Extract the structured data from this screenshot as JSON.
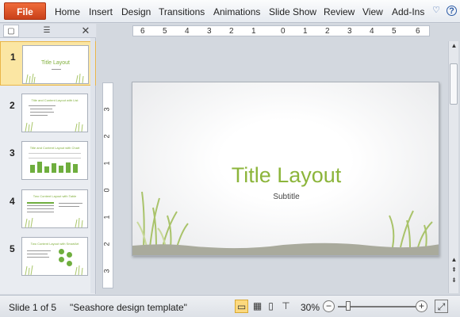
{
  "ribbon": {
    "file_label": "File",
    "tabs": [
      "Home",
      "Insert",
      "Design",
      "Transitions",
      "Animations",
      "Slide Show",
      "Review",
      "View",
      "Add-Ins"
    ]
  },
  "panel": {
    "tab_slides_icon": "slides-tab-icon",
    "tab_outline_icon": "outline-tab-icon",
    "close_glyph": "✕",
    "thumbs": [
      {
        "num": "1",
        "title": "Title Layout",
        "selected": true
      },
      {
        "num": "2",
        "title": "Title and Content Layout with List",
        "selected": false
      },
      {
        "num": "3",
        "title": "Title and Content Layout with Chart",
        "selected": false
      },
      {
        "num": "4",
        "title": "Two Content Layout with Table",
        "selected": false
      },
      {
        "num": "5",
        "title": "Two Content Layout with SmartArt",
        "selected": false
      }
    ]
  },
  "ruler": {
    "h_ticks": [
      "6",
      "5",
      "4",
      "3",
      "2",
      "1",
      "0",
      "1",
      "2",
      "3",
      "4",
      "5",
      "6"
    ],
    "v_ticks": [
      "3",
      "2",
      "1",
      "0",
      "1",
      "2",
      "3"
    ]
  },
  "slide": {
    "title": "Title Layout",
    "subtitle": "Subtitle"
  },
  "status": {
    "slide_counter": "Slide 1 of 5",
    "theme_name": "\"Seashore design template\"",
    "zoom": "30%",
    "zoom_out": "−",
    "zoom_in": "+"
  },
  "colors": {
    "accent_green": "#8cb53b",
    "file_orange": "#e05a2a",
    "selection": "#fbe6a3"
  }
}
